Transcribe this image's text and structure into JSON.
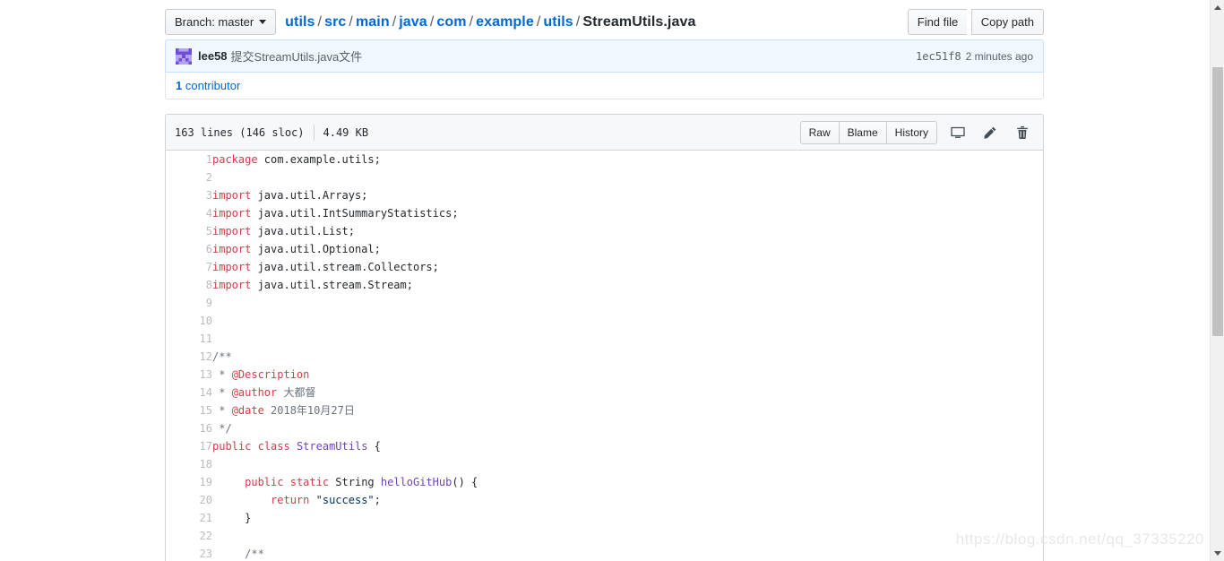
{
  "file_navigation": {
    "branch_label": "Branch: master",
    "breadcrumb": [
      {
        "text": "utils",
        "link": true
      },
      {
        "text": "src",
        "link": true
      },
      {
        "text": "main",
        "link": true
      },
      {
        "text": "java",
        "link": true
      },
      {
        "text": "com",
        "link": true
      },
      {
        "text": "example",
        "link": true
      },
      {
        "text": "utils",
        "link": true
      },
      {
        "text": "StreamUtils.java",
        "link": false
      }
    ],
    "separator": "/",
    "find_file_label": "Find file",
    "copy_path_label": "Copy path"
  },
  "commit": {
    "author": "lee58",
    "message": "提交StreamUtils.java文件",
    "sha": "1ec51f8",
    "time": "2 minutes ago",
    "avatar_color": "#8c7ae6"
  },
  "contributors": {
    "count": "1",
    "label": "contributor"
  },
  "file_header": {
    "lines": "163 lines (146 sloc)",
    "size": "4.49 KB",
    "raw_label": "Raw",
    "blame_label": "Blame",
    "history_label": "History",
    "desktop_icon": "desktop-download-icon",
    "edit_icon": "pencil-icon",
    "delete_icon": "trash-icon"
  },
  "code": {
    "lines": [
      {
        "n": "1",
        "tokens": [
          {
            "t": "package",
            "c": "k"
          },
          {
            "t": " com.example.utils;",
            "c": "t"
          }
        ]
      },
      {
        "n": "2",
        "tokens": []
      },
      {
        "n": "3",
        "tokens": [
          {
            "t": "import",
            "c": "k"
          },
          {
            "t": " java.util.Arrays;",
            "c": "t"
          }
        ]
      },
      {
        "n": "4",
        "tokens": [
          {
            "t": "import",
            "c": "k"
          },
          {
            "t": " java.util.IntSummaryStatistics;",
            "c": "t"
          }
        ]
      },
      {
        "n": "5",
        "tokens": [
          {
            "t": "import",
            "c": "k"
          },
          {
            "t": " java.util.List;",
            "c": "t"
          }
        ]
      },
      {
        "n": "6",
        "tokens": [
          {
            "t": "import",
            "c": "k"
          },
          {
            "t": " java.util.Optional;",
            "c": "t"
          }
        ]
      },
      {
        "n": "7",
        "tokens": [
          {
            "t": "import",
            "c": "k"
          },
          {
            "t": " java.util.stream.Collectors;",
            "c": "t"
          }
        ]
      },
      {
        "n": "8",
        "tokens": [
          {
            "t": "import",
            "c": "k"
          },
          {
            "t": " java.util.stream.Stream;",
            "c": "t"
          }
        ]
      },
      {
        "n": "9",
        "tokens": []
      },
      {
        "n": "10",
        "tokens": []
      },
      {
        "n": "11",
        "tokens": []
      },
      {
        "n": "12",
        "tokens": [
          {
            "t": "/**",
            "c": "c"
          }
        ]
      },
      {
        "n": "13",
        "tokens": [
          {
            "t": " * ",
            "c": "c"
          },
          {
            "t": "@Description",
            "c": "ca"
          }
        ]
      },
      {
        "n": "14",
        "tokens": [
          {
            "t": " * ",
            "c": "c"
          },
          {
            "t": "@author",
            "c": "ca"
          },
          {
            "t": " 大都督",
            "c": "c"
          }
        ]
      },
      {
        "n": "15",
        "tokens": [
          {
            "t": " * ",
            "c": "c"
          },
          {
            "t": "@date",
            "c": "ca"
          },
          {
            "t": " 2018年10月27日",
            "c": "c"
          }
        ]
      },
      {
        "n": "16",
        "tokens": [
          {
            "t": " */",
            "c": "c"
          }
        ]
      },
      {
        "n": "17",
        "tokens": [
          {
            "t": "public",
            "c": "k"
          },
          {
            "t": " ",
            "c": "t"
          },
          {
            "t": "class",
            "c": "k"
          },
          {
            "t": " ",
            "c": "t"
          },
          {
            "t": "StreamUtils",
            "c": "fn"
          },
          {
            "t": " {",
            "c": "t"
          }
        ]
      },
      {
        "n": "18",
        "tokens": []
      },
      {
        "n": "19",
        "tokens": [
          {
            "t": "     ",
            "c": "t"
          },
          {
            "t": "public",
            "c": "k"
          },
          {
            "t": " ",
            "c": "t"
          },
          {
            "t": "static",
            "c": "k"
          },
          {
            "t": " String ",
            "c": "t"
          },
          {
            "t": "helloGitHub",
            "c": "fn"
          },
          {
            "t": "() {",
            "c": "t"
          }
        ]
      },
      {
        "n": "20",
        "tokens": [
          {
            "t": "         ",
            "c": "t"
          },
          {
            "t": "return",
            "c": "k"
          },
          {
            "t": " ",
            "c": "t"
          },
          {
            "t": "\"success\"",
            "c": "s"
          },
          {
            "t": ";",
            "c": "t"
          }
        ]
      },
      {
        "n": "21",
        "tokens": [
          {
            "t": "     }",
            "c": "t"
          }
        ]
      },
      {
        "n": "22",
        "tokens": []
      },
      {
        "n": "23",
        "tokens": [
          {
            "t": "     ",
            "c": "t"
          },
          {
            "t": "/**",
            "c": "c"
          }
        ]
      }
    ]
  },
  "watermark": {
    "text": "https://blog.csdn.net/qq_37335220"
  }
}
